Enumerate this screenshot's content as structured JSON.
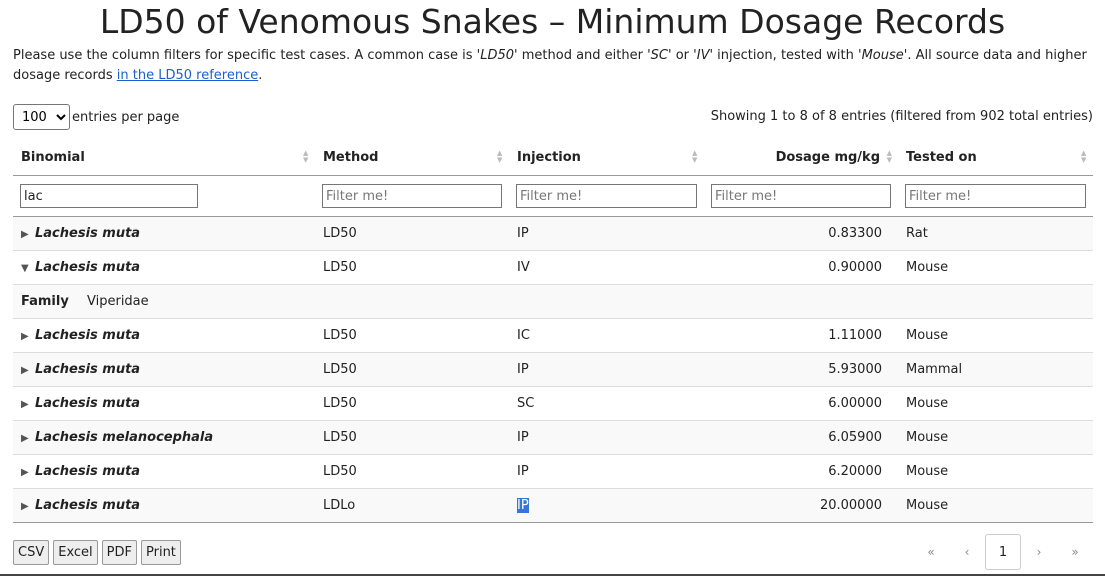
{
  "title": "LD50 of Venomous Snakes – Minimum Dosage Records",
  "intro": {
    "p1": "Please use the column filters for specific test cases. A common case is ",
    "m1": "'LD50'",
    "p2": " method and either ",
    "m2": "'SC'",
    "p3": " or ",
    "m3": "'IV'",
    "p4": " injection, tested with ",
    "m4": "'Mouse'",
    "p5": ". All source data and higher dosage records ",
    "link": "in the LD50 reference",
    "p6": "."
  },
  "length": {
    "selected": "100",
    "label": "entries per page"
  },
  "info": "Showing 1 to 8 of 8 entries (filtered from 902 total entries)",
  "columns": [
    "Binomial",
    "Method",
    "Injection",
    "Dosage mg/kg",
    "Tested on"
  ],
  "filters": {
    "binomial_value": "lac",
    "placeholder": "Filter me!"
  },
  "rows": [
    {
      "binomial": "Lachesis muta",
      "method": "LD50",
      "injection": "IP",
      "dosage": "0.83300",
      "tested": "Rat",
      "arrow": "▶"
    },
    {
      "binomial": "Lachesis muta",
      "method": "LD50",
      "injection": "IV",
      "dosage": "0.90000",
      "tested": "Mouse",
      "arrow": "▼"
    },
    {
      "binomial": "Lachesis muta",
      "method": "LD50",
      "injection": "IC",
      "dosage": "1.11000",
      "tested": "Mouse",
      "arrow": "▶"
    },
    {
      "binomial": "Lachesis muta",
      "method": "LD50",
      "injection": "IP",
      "dosage": "5.93000",
      "tested": "Mammal",
      "arrow": "▶"
    },
    {
      "binomial": "Lachesis muta",
      "method": "LD50",
      "injection": "SC",
      "dosage": "6.00000",
      "tested": "Mouse",
      "arrow": "▶"
    },
    {
      "binomial": "Lachesis melanocephala",
      "method": "LD50",
      "injection": "IP",
      "dosage": "6.05900",
      "tested": "Mouse",
      "arrow": "▶"
    },
    {
      "binomial": "Lachesis muta",
      "method": "LD50",
      "injection": "IP",
      "dosage": "6.20000",
      "tested": "Mouse",
      "arrow": "▶"
    },
    {
      "binomial": "Lachesis muta",
      "method": "LDLo",
      "injection": "IP",
      "dosage": "20.00000",
      "tested": "Mouse",
      "arrow": "▶"
    }
  ],
  "child": {
    "label": "Family",
    "value": "Viperidae"
  },
  "buttons": {
    "csv": "CSV",
    "excel": "Excel",
    "pdf": "PDF",
    "print": "Print"
  },
  "pager": {
    "first": "«",
    "prev": "‹",
    "current": "1",
    "next": "›",
    "last": "»"
  }
}
